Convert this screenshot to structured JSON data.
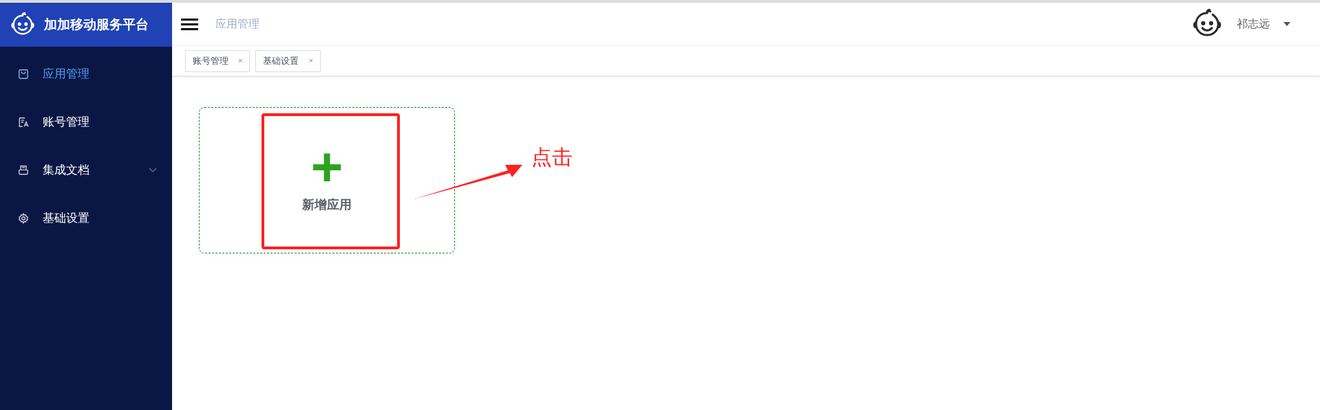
{
  "brand": {
    "title": "加加移动服务平台"
  },
  "sidebar": {
    "items": [
      {
        "label": "应用管理",
        "selected": true
      },
      {
        "label": "账号管理",
        "selected": false
      },
      {
        "label": "集成文档",
        "selected": false,
        "expanded": false
      },
      {
        "label": "基础设置",
        "selected": false
      }
    ]
  },
  "header": {
    "breadcrumb": "应用管理",
    "user": "祁志远"
  },
  "tabs": [
    {
      "label": "账号管理",
      "close": "×"
    },
    {
      "label": "基础设置",
      "close": "×"
    }
  ],
  "add_card": {
    "plus": "+",
    "label": "新增应用"
  },
  "annotation": {
    "text": "点击"
  }
}
